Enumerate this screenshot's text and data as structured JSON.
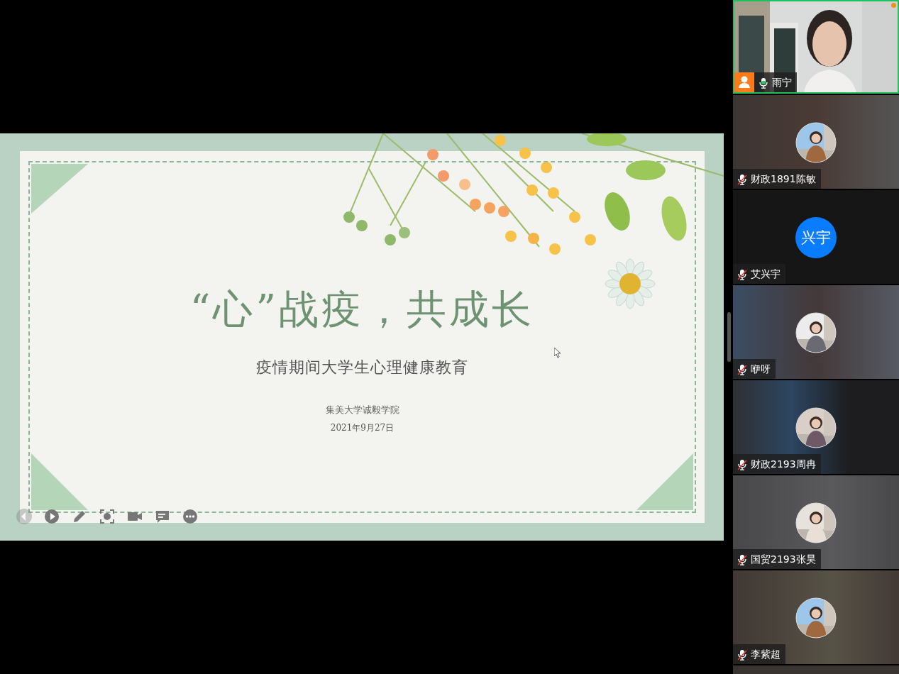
{
  "slide": {
    "title": "“心”战疫，共成长",
    "subtitle": "疫情期间大学生心理健康教育",
    "organization": "集美大学诚毅学院",
    "date": "2021年9月27日"
  },
  "participants": [
    {
      "name": "雨宁",
      "kind": "video",
      "muted": false,
      "speaking": true
    },
    {
      "name": "财政1891陈敏",
      "kind": "avatar",
      "muted": true,
      "speaking": false
    },
    {
      "name": "艾兴宇",
      "kind": "initials",
      "initials": "兴宇",
      "muted": true,
      "speaking": false
    },
    {
      "name": "咿呀",
      "kind": "avatar",
      "muted": true,
      "speaking": false
    },
    {
      "name": "财政2193周冉",
      "kind": "avatar",
      "muted": true,
      "speaking": false
    },
    {
      "name": "国贸2193张昊",
      "kind": "avatar",
      "muted": true,
      "speaking": false
    },
    {
      "name": "李紫超",
      "kind": "avatar",
      "muted": true,
      "speaking": false
    }
  ]
}
